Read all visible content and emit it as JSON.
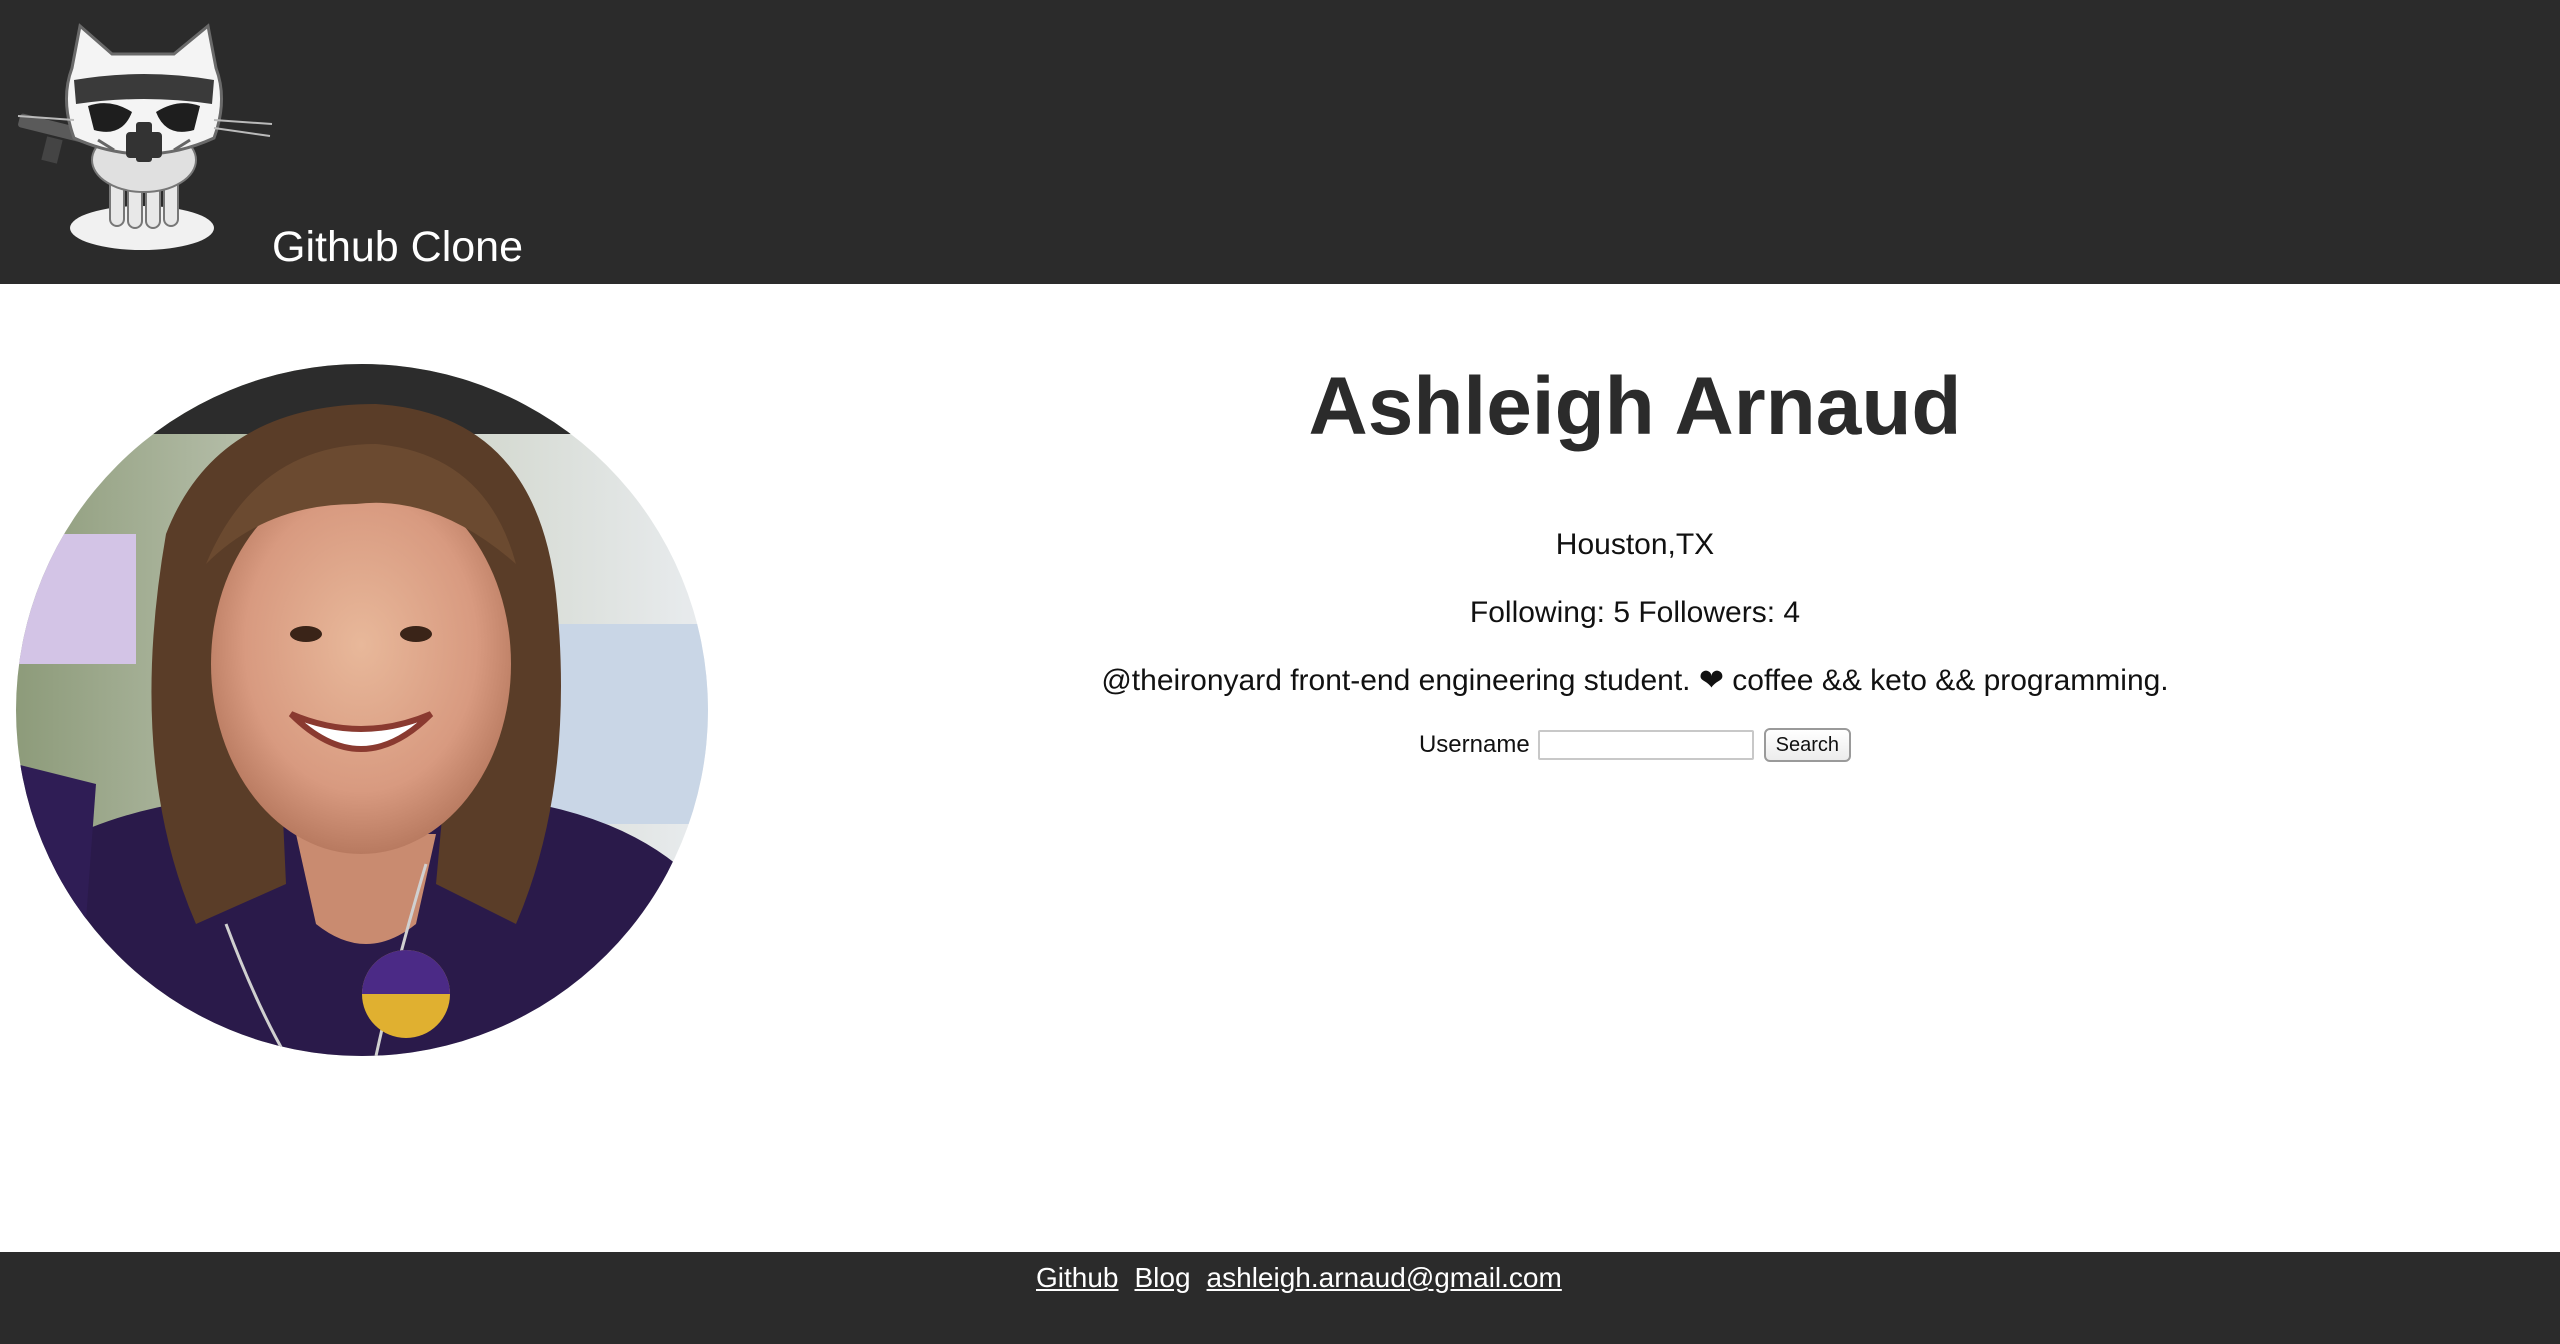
{
  "header": {
    "logo_name": "stormtroopocat-icon",
    "title": "Github Clone"
  },
  "profile": {
    "name": "Ashleigh Arnaud",
    "location": "Houston,TX",
    "following_label": "Following:",
    "following_count": "5",
    "followers_label": "Followers:",
    "followers_count": "4",
    "bio": "@theironyard front-end engineering student. ❤ coffee && keto && programming."
  },
  "search": {
    "label": "Username",
    "value": "",
    "placeholder": "",
    "button_label": "Search"
  },
  "footer": {
    "links": [
      {
        "label": "Github"
      },
      {
        "label": "Blog"
      },
      {
        "label": "ashleigh.arnaud@gmail.com"
      }
    ]
  },
  "colors": {
    "header_bg": "#2b2b2b",
    "footer_bg": "#2b2b2b",
    "text": "#2b2b2b",
    "body_bg": "#ffffff"
  }
}
